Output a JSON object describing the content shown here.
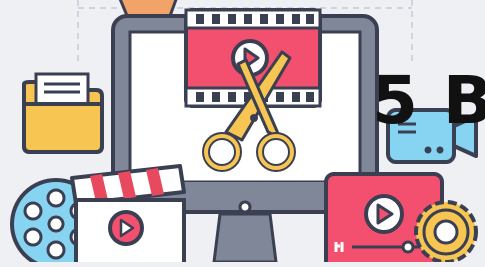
{
  "headline": {
    "text": "5 B"
  },
  "illustration": {
    "subject": "video-editing",
    "icons": [
      "folder-icon",
      "monitor-icon",
      "filmstrip-icon",
      "play-icon",
      "scissors-icon",
      "video-camera-icon",
      "film-reel-icon",
      "clapperboard-icon",
      "video-player-icon",
      "gear-icon"
    ]
  },
  "colors": {
    "background": "#eef0f4",
    "outline": "#3b3f52",
    "accent_pink": "#f2506e",
    "accent_yellow": "#f6c552",
    "accent_blue": "#86d4f2",
    "accent_orange": "#f2a36a",
    "accent_red": "#e8495f",
    "monitor_grey": "#7f8799",
    "screen_white": "#ffffff"
  }
}
